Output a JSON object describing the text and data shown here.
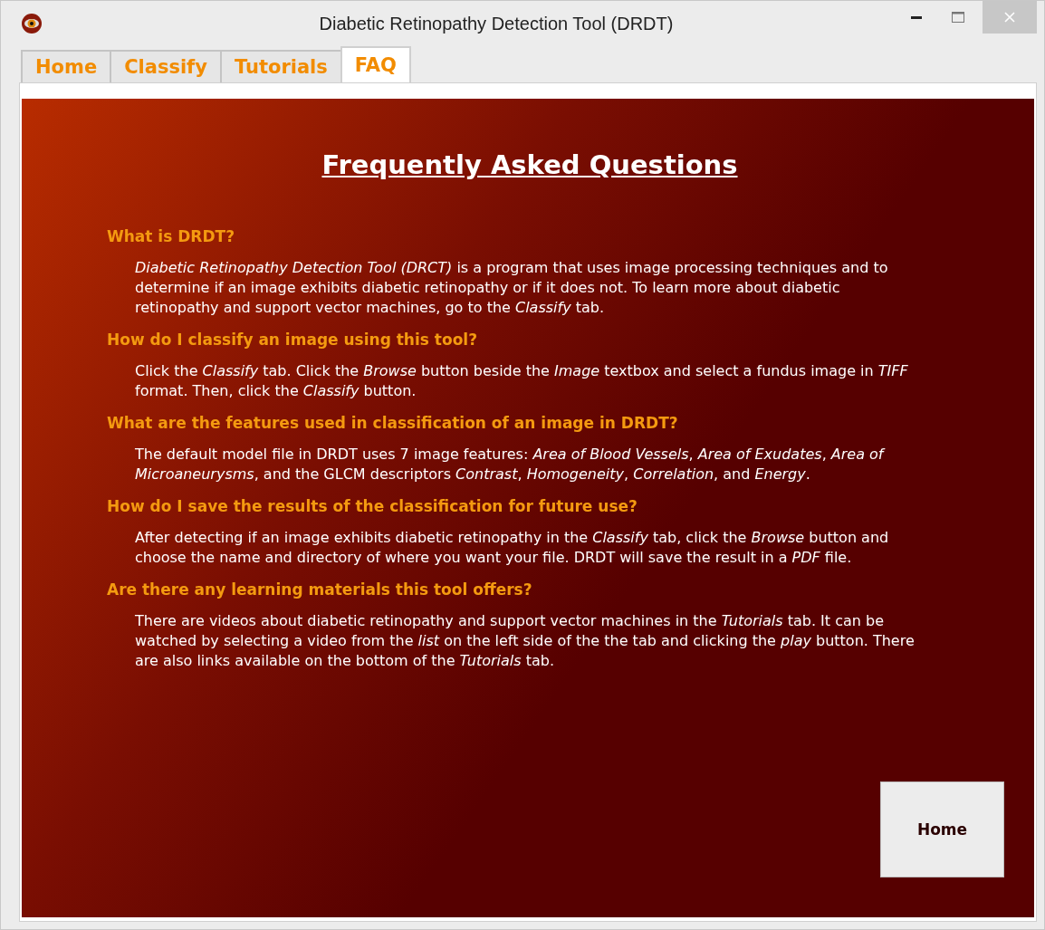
{
  "window": {
    "title": "Diabetic Retinopathy Detection Tool (DRDT)"
  },
  "tabs": [
    {
      "label": "Home",
      "selected": false
    },
    {
      "label": "Classify",
      "selected": false
    },
    {
      "label": "Tutorials",
      "selected": false
    },
    {
      "label": "FAQ",
      "selected": true
    }
  ],
  "heading": "Frequently Asked Questions",
  "faq": [
    {
      "question": "What is DRDT?",
      "answer": "*Diabetic Retinopathy Detection Tool (DRCT)* is a program that uses image processing techniques and to determine if an image exhibits diabetic retinopathy or if it does not. To learn more about diabetic retinopathy and support vector machines, go to the *Classify* tab."
    },
    {
      "question": "How do I classify an image using this tool?",
      "answer": "Click the *Classify* tab. Click the *Browse* button beside the *Image* textbox and select a fundus image in *TIFF* format. Then, click the *Classify* button."
    },
    {
      "question": "What are the features used in classification of an image in DRDT?",
      "answer": "The default model file in DRDT uses 7 image features: *Area of Blood Vessels*, *Area of Exudates*, *Area of Microaneurysms*, and the GLCM descriptors *Contrast*, *Homogeneity*, *Correlation*, and *Energy*."
    },
    {
      "question": "How do I save the results of the classification for future use?",
      "answer": "After detecting if an image exhibits diabetic retinopathy in the *Classify* tab, click the *Browse* button and choose the name and directory of where you want your file. DRDT will save the result in a *PDF* file."
    },
    {
      "question": "Are there any learning materials this tool offers?",
      "answer": "There are videos about diabetic retinopathy and support vector machines in the *Tutorials* tab. It can be watched by selecting a video from the *list* on the left side of the the tab and clicking the *play* button. There are also links available on the bottom of the *Tutorials* tab."
    }
  ],
  "home_button": "Home"
}
